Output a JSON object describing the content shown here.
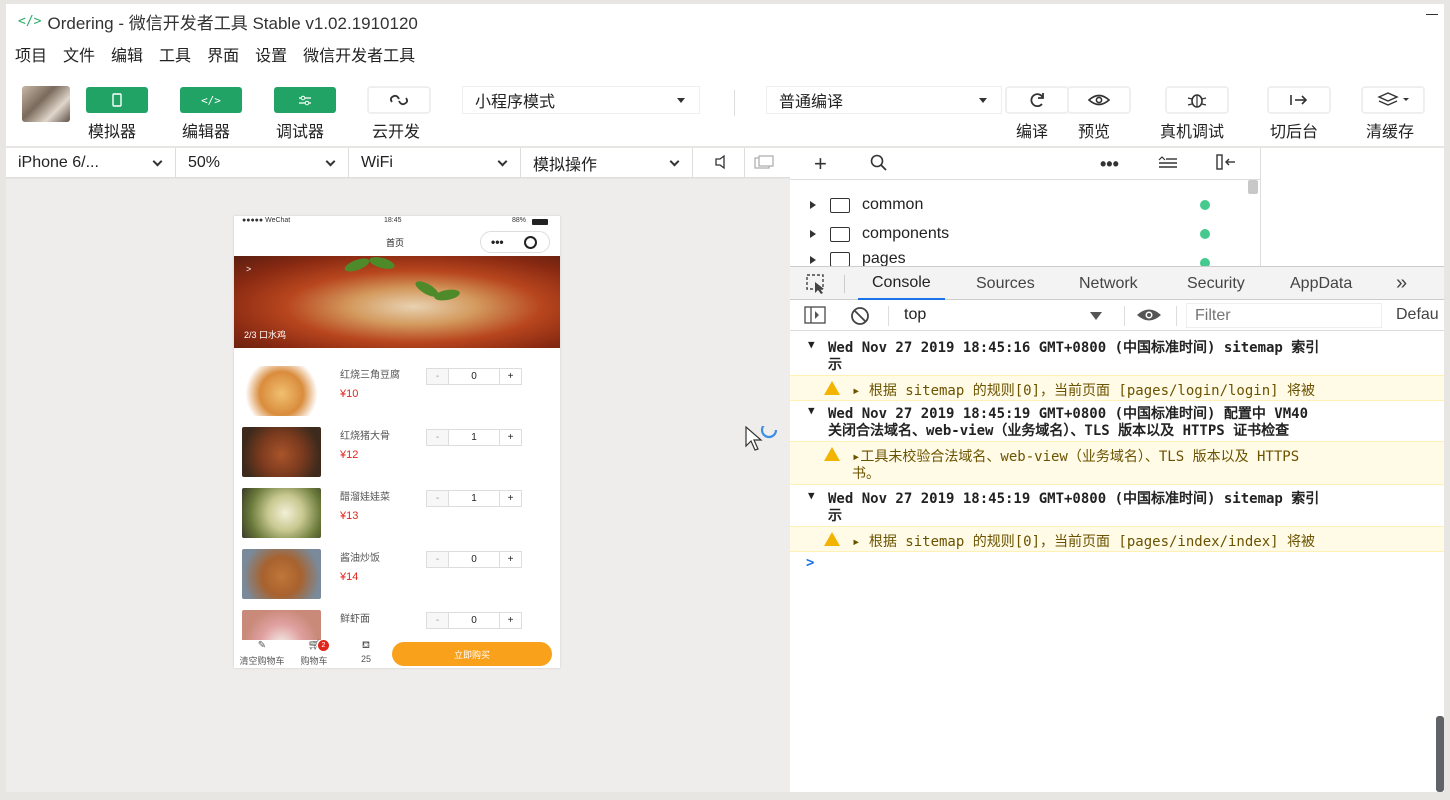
{
  "window": {
    "title": "Ordering - 微信开发者工具 Stable v1.02.1910120"
  },
  "menu": [
    "项目",
    "文件",
    "编辑",
    "工具",
    "界面",
    "设置",
    "微信开发者工具"
  ],
  "toolbar": {
    "simulator": "模拟器",
    "editor": "编辑器",
    "debugger": "调试器",
    "cloud": "云开发",
    "mode_select": "小程序模式",
    "compile_select": "普通编译",
    "compile": "编译",
    "preview": "预览",
    "remote_debug": "真机调试",
    "background": "切后台",
    "clear_cache": "清缓存"
  },
  "device_bar": {
    "device": "iPhone 6/...",
    "zoom": "50%",
    "network": "WiFi",
    "operation": "模拟操作"
  },
  "phone": {
    "carrier": "●●●●● WeChat",
    "time": "18:45",
    "battery": "88%",
    "nav_title": "首页",
    "banner_caption": "2/3 口水鸡",
    "dishes": [
      {
        "name": "红烧三角豆腐",
        "price": "¥10",
        "qty": "0",
        "img_color": "#d98c3c"
      },
      {
        "name": "红烧猪大骨",
        "price": "¥12",
        "qty": "1",
        "img_color": "#7a3a1e"
      },
      {
        "name": "醋溜娃娃菜",
        "price": "¥13",
        "qty": "1",
        "img_color": "#9aa05a"
      },
      {
        "name": "酱油炒饭",
        "price": "¥14",
        "qty": "0",
        "img_color": "#a8622e"
      },
      {
        "name": "鲜虾面",
        "price": "",
        "qty": "0",
        "img_color": "#c98a7a"
      }
    ],
    "tabbar": {
      "clear_cart": "清空购物车",
      "cart": "购物车",
      "cart_badge": "2",
      "total": "25",
      "buy": "立即购买"
    }
  },
  "filetree": {
    "items": [
      "common",
      "components",
      "pages"
    ]
  },
  "devtools": {
    "tabs": [
      "Console",
      "Sources",
      "Network",
      "Security",
      "AppData",
      "»"
    ],
    "context": "top",
    "filter_placeholder": "Filter",
    "level": "Defau",
    "logs": [
      {
        "type": "info",
        "line1": "Wed Nov 27 2019 18:45:16 GMT+0800 (中国标准时间) sitemap 索引",
        "line2": "示"
      },
      {
        "type": "warn",
        "line1": "▸ 根据 sitemap 的规则[0]，当前页面 [pages/login/login] 将被"
      },
      {
        "type": "info",
        "line1": "Wed Nov 27 2019 18:45:19 GMT+0800 (中国标准时间) 配置中  VM40",
        "line2": "关闭合法域名、web-view（业务域名）、TLS 版本以及 HTTPS 证书检查"
      },
      {
        "type": "warn",
        "line1": "▸工具未校验合法域名、web-view（业务域名）、TLS 版本以及 HTTPS",
        "line2": "书。"
      },
      {
        "type": "info",
        "line1": "Wed Nov 27 2019 18:45:19 GMT+0800 (中国标准时间) sitemap 索引",
        "line2": "示"
      },
      {
        "type": "warn",
        "line1": "▸ 根据 sitemap 的规则[0]，当前页面 [pages/index/index] 将被"
      }
    ],
    "prompt": ">"
  },
  "colors": {
    "accent_green": "#21a366",
    "warn_bg": "#fffbe6",
    "price_red": "#e0251d",
    "buy_orange": "#f9a11b"
  }
}
